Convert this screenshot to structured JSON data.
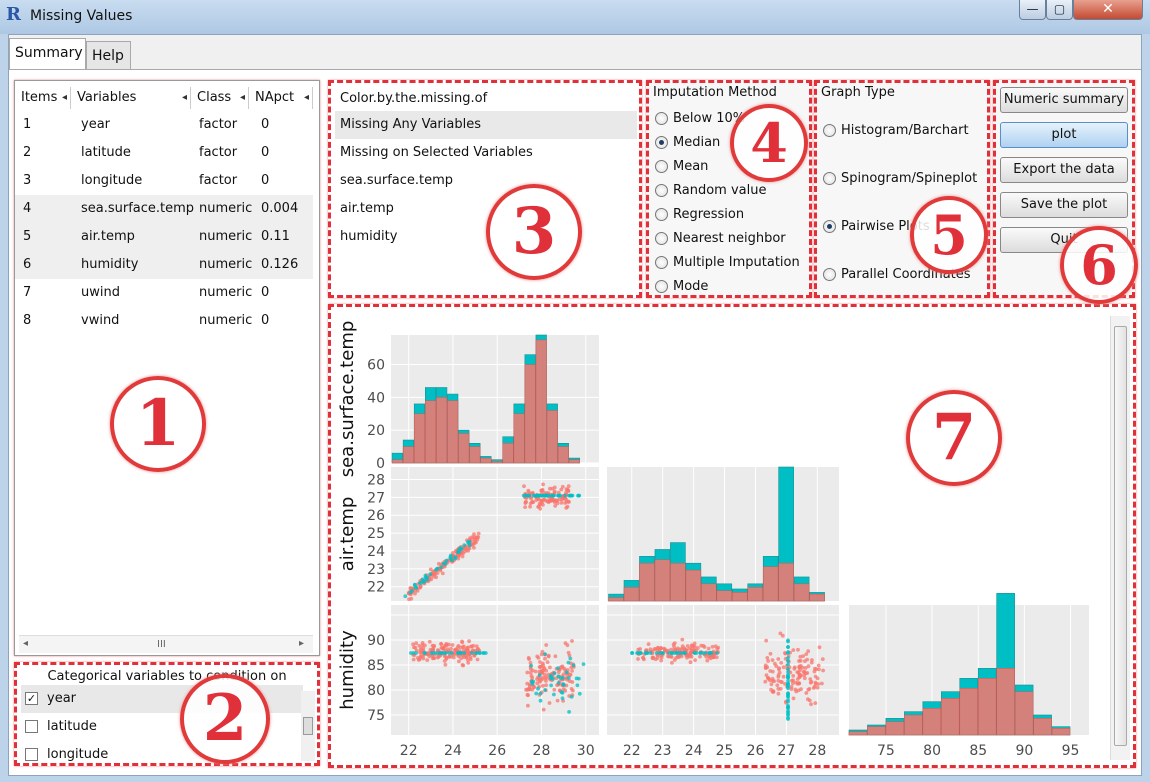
{
  "window": {
    "title": "Missing Values",
    "app_icon": "R",
    "min_glyph": "—",
    "max_glyph": "▢",
    "close_glyph": "✕"
  },
  "tabs": [
    {
      "label": "Summary",
      "active": true
    },
    {
      "label": "Help",
      "active": false
    }
  ],
  "variables_table": {
    "columns": [
      "Items",
      "Variables",
      "Class",
      "NApct"
    ],
    "rows": [
      {
        "item": "1",
        "variable": "year",
        "class": "factor",
        "napct": "0",
        "highlight": false
      },
      {
        "item": "2",
        "variable": "latitude",
        "class": "factor",
        "napct": "0",
        "highlight": false
      },
      {
        "item": "3",
        "variable": "longitude",
        "class": "factor",
        "napct": "0",
        "highlight": false
      },
      {
        "item": "4",
        "variable": "sea.surface.temp",
        "class": "numeric",
        "napct": "0.004",
        "highlight": true
      },
      {
        "item": "5",
        "variable": "air.temp",
        "class": "numeric",
        "napct": "0.11",
        "highlight": true
      },
      {
        "item": "6",
        "variable": "humidity",
        "class": "numeric",
        "napct": "0.126",
        "highlight": true
      },
      {
        "item": "7",
        "variable": "uwind",
        "class": "numeric",
        "napct": "0",
        "highlight": false
      },
      {
        "item": "8",
        "variable": "vwind",
        "class": "numeric",
        "napct": "0",
        "highlight": false
      }
    ],
    "scroll_left": "◂",
    "scroll_right": "▸",
    "scroll_grip": "III"
  },
  "categorical": {
    "title": "Categorical variables to condition on",
    "items": [
      {
        "label": "year",
        "checked": true
      },
      {
        "label": "latitude",
        "checked": false
      },
      {
        "label": "longitude",
        "checked": false
      }
    ]
  },
  "color_by": {
    "header": "Color.by.the.missing.of",
    "items": [
      "Missing Any Variables",
      "Missing on Selected Variables",
      "sea.surface.temp",
      "air.temp",
      "humidity"
    ],
    "selected_index": 0
  },
  "imputation": {
    "title": "Imputation Method",
    "options": [
      "Below 10%",
      "Median",
      "Mean",
      "Random value",
      "Regression",
      "Nearest neighbor",
      "Multiple Imputation",
      "Mode"
    ],
    "selected": "Median"
  },
  "graph_type": {
    "title": "Graph Type",
    "options": [
      "Histogram/Barchart",
      "Spinogram/Spineplot",
      "Pairwise Plots",
      "Parallel Coordinates"
    ],
    "selected": "Pairwise Plots"
  },
  "actions": {
    "numeric_summary": "Numeric summary",
    "plot": "plot",
    "export": "Export the data",
    "save_plot": "Save the plot",
    "quit": "Quit"
  },
  "annotations": [
    "1",
    "2",
    "3",
    "4",
    "5",
    "6",
    "7"
  ],
  "colors": {
    "observed": "#f8766d",
    "missing": "#00bfc4",
    "panel_bg": "#ebebeb",
    "annotation": "#e0303a"
  },
  "chart_data": {
    "type": "scatter",
    "variables": [
      "sea.surface.temp",
      "air.temp",
      "humidity"
    ],
    "y_axis_labels": [
      "sea.surface.temp",
      "air.temp",
      "humidity"
    ],
    "x_axis_labels": [
      "sea.surface.temp",
      "air.temp",
      "humidity"
    ],
    "ticks": {
      "sea.surface.temp": [
        22,
        24,
        26,
        28,
        30
      ],
      "air.temp": [
        22,
        23,
        24,
        25,
        26,
        27,
        28
      ],
      "humidity": [
        75,
        80,
        85,
        90,
        95
      ],
      "count": [
        0,
        20,
        40,
        60
      ]
    },
    "ranges": {
      "sea.surface.temp": [
        21.2,
        30.6
      ],
      "air.temp": [
        21.2,
        28.7
      ],
      "humidity": [
        71,
        97
      ],
      "count": [
        0,
        78
      ]
    },
    "hist_sst": {
      "bins": [
        21.5,
        22,
        22.5,
        23,
        23.5,
        24,
        24.5,
        25,
        25.5,
        26,
        26.5,
        27,
        27.5,
        28,
        28.5,
        29,
        29.5
      ],
      "observed": [
        2,
        10,
        30,
        38,
        40,
        38,
        18,
        10,
        3,
        1,
        12,
        30,
        60,
        75,
        32,
        10,
        2
      ],
      "missing": [
        6,
        14,
        36,
        46,
        46,
        42,
        20,
        12,
        4,
        2,
        16,
        36,
        66,
        78,
        36,
        12,
        3
      ]
    },
    "hist_air": {
      "bins": [
        21.5,
        22,
        22.5,
        23,
        23.5,
        24,
        24.5,
        25,
        25.5,
        26,
        26.5,
        27,
        27.5,
        28
      ],
      "observed": [
        2,
        8,
        22,
        24,
        22,
        18,
        10,
        6,
        5,
        8,
        20,
        22,
        10,
        4
      ],
      "missing": [
        4,
        12,
        26,
        30,
        34,
        22,
        14,
        10,
        7,
        10,
        26,
        78,
        14,
        5
      ]
    },
    "hist_hum": {
      "bins": [
        72,
        74,
        76,
        78,
        80,
        82,
        84,
        86,
        88,
        90,
        92,
        94
      ],
      "observed": [
        2,
        5,
        8,
        12,
        16,
        22,
        28,
        34,
        40,
        26,
        10,
        4
      ],
      "missing": [
        3,
        6,
        10,
        14,
        20,
        26,
        34,
        40,
        85,
        30,
        12,
        5
      ]
    },
    "legend": "none",
    "grid": true
  }
}
